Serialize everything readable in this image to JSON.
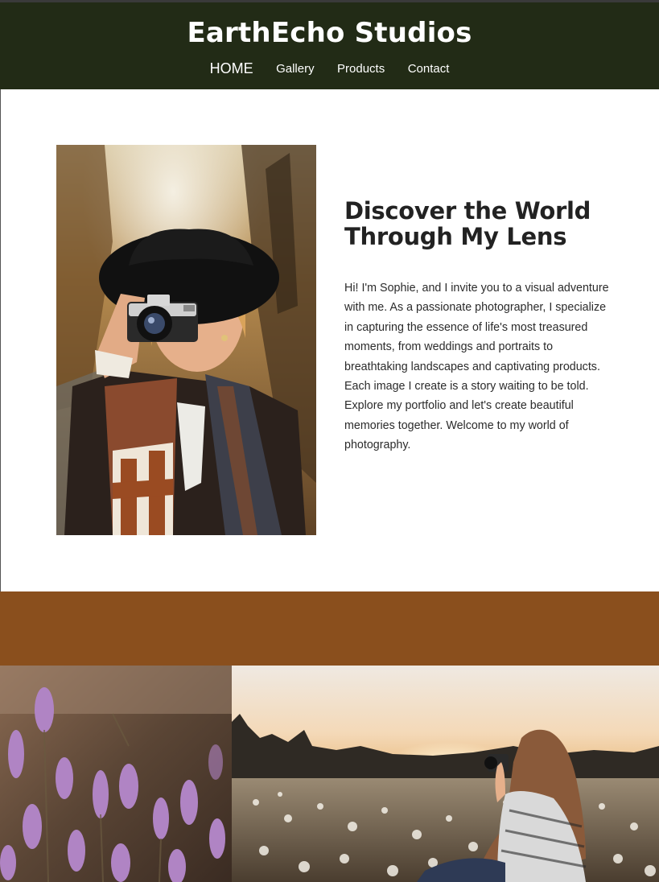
{
  "site": {
    "brand": "EarthEcho Studios"
  },
  "nav": {
    "items": [
      {
        "label": "HOME"
      },
      {
        "label": "Gallery"
      },
      {
        "label": "Products"
      },
      {
        "label": "Contact"
      }
    ]
  },
  "hero": {
    "title_line1": "Discover the World",
    "title_line2": "Through My Lens",
    "body": "Hi! I'm Sophie, and I invite you to a visual adventure with me. As a passionate photographer, I specialize in capturing the essence of life's most treasured moments, from weddings and portraits to breathtaking landscapes and captivating products. Each image I create is a story waiting to be told. Explore my portfolio and let's create beautiful memories together. Welcome to my world of photography."
  },
  "colors": {
    "header_bg": "#222b16",
    "band_bg": "#8a4f1d"
  }
}
